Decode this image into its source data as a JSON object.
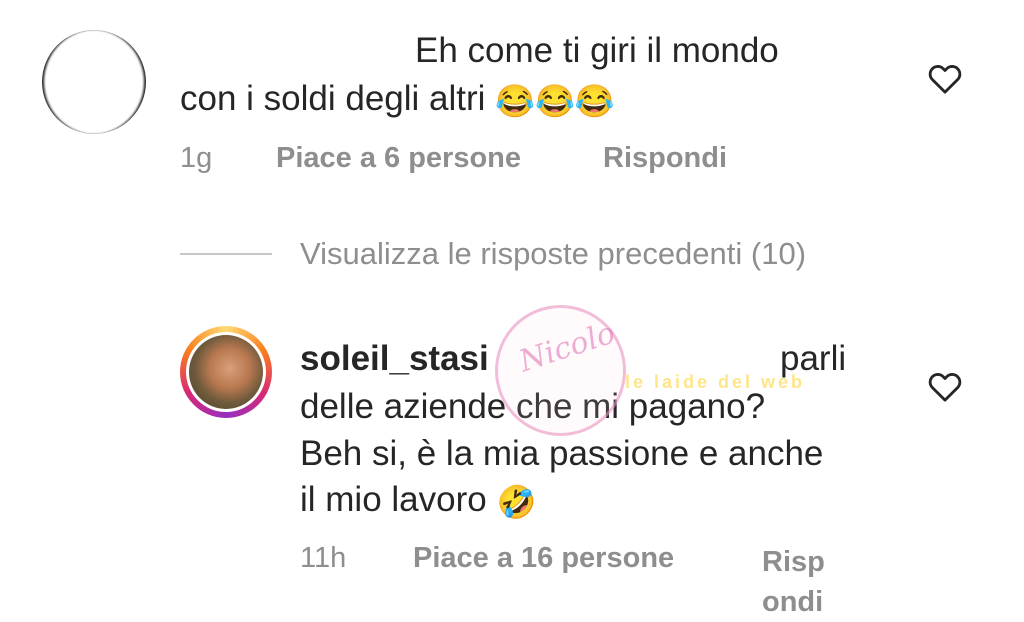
{
  "comment1": {
    "line1": "Eh come ti giri il mondo",
    "line2": "con i soldi degli altri",
    "emojis": "😂😂😂",
    "time": "1g",
    "likes": "Piace a 6 persone",
    "reply": "Rispondi"
  },
  "replies": {
    "view_previous": "Visualizza le risposte precedenti (10)"
  },
  "comment2": {
    "username": "soleil_stasi",
    "line1_end": "parli",
    "line2": "delle aziende che mi pagano?",
    "line3": "Beh si, è la mia passione e anche",
    "line4": "il mio lavoro",
    "emoji": "🤣",
    "time": "11h",
    "likes": "Piace a 16 persone",
    "reply_part1": "Risp",
    "reply_part2": "ondi"
  },
  "watermark": {
    "circle_text": "Nicolo",
    "banner_text": "le laide del web"
  },
  "icons": {
    "like": "heart-outline-icon"
  },
  "colors": {
    "text": "#262626",
    "secondary": "#8e8e8e",
    "divider": "#c7c7c7"
  }
}
